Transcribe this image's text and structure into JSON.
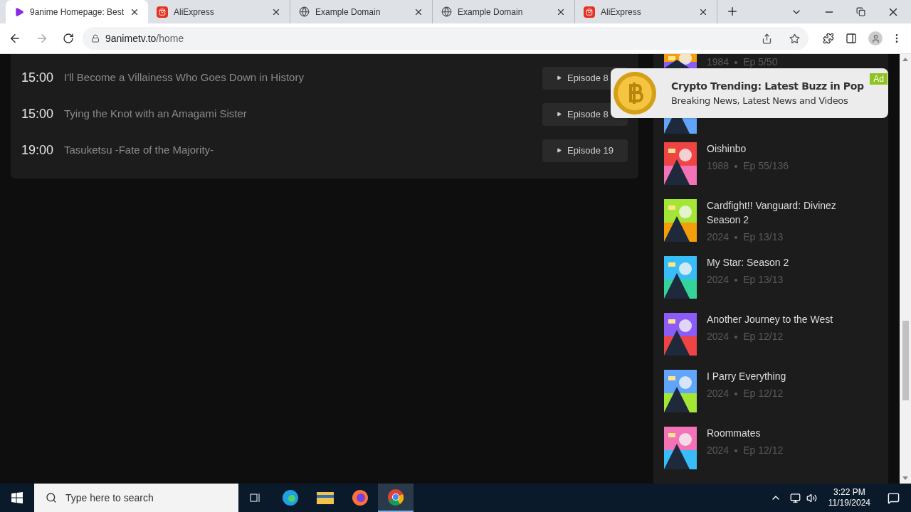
{
  "browser": {
    "tabs": [
      {
        "title": "9anime Homepage: Best",
        "kind": "play",
        "selected": true
      },
      {
        "title": "AliExpress",
        "kind": "shop",
        "selected": false
      },
      {
        "title": "Example Domain",
        "kind": "globe",
        "selected": false
      },
      {
        "title": "Example Domain",
        "kind": "globe",
        "selected": false
      },
      {
        "title": "AliExpress",
        "kind": "shop",
        "selected": false
      }
    ],
    "url": {
      "host": "9animetv.to",
      "path": "/home"
    }
  },
  "schedule": [
    {
      "time": "15:00",
      "title": "I'll Become a Villainess Who Goes Down in History",
      "episode": "Episode 8"
    },
    {
      "time": "15:00",
      "title": "Tying the Knot with an Amagami Sister",
      "episode": "Episode 8"
    },
    {
      "time": "19:00",
      "title": "Tasuketsu -Fate of the Majority-",
      "episode": "Episode 19"
    }
  ],
  "sidebar": [
    {
      "kind": "cut",
      "year": "1984",
      "episodes": "Ep 5/50"
    },
    {
      "kind": "hidden"
    },
    {
      "kind": "full",
      "title": "Oishinbo",
      "year": "1988",
      "episodes": "Ep 55/136"
    },
    {
      "kind": "full",
      "title": "Cardfight!! Vanguard: Divinez Season 2",
      "year": "2024",
      "episodes": "Ep 13/13"
    },
    {
      "kind": "full",
      "title": "My Star: Season 2",
      "year": "2024",
      "episodes": "Ep 13/13"
    },
    {
      "kind": "full",
      "title": "Another Journey to the West",
      "year": "2024",
      "episodes": "Ep 12/12"
    },
    {
      "kind": "full",
      "title": "I Parry Everything",
      "year": "2024",
      "episodes": "Ep 12/12"
    },
    {
      "kind": "full",
      "title": "Roommates",
      "year": "2024",
      "episodes": "Ep 12/12"
    }
  ],
  "ad": {
    "title": "Crypto Trending: Latest Buzz in Pop",
    "text": "Breaking News, Latest News and Videos",
    "badge": "Ad"
  },
  "taskbar": {
    "search_placeholder": "Type here to search",
    "time": "3:22 PM",
    "date": "11/19/2024"
  }
}
